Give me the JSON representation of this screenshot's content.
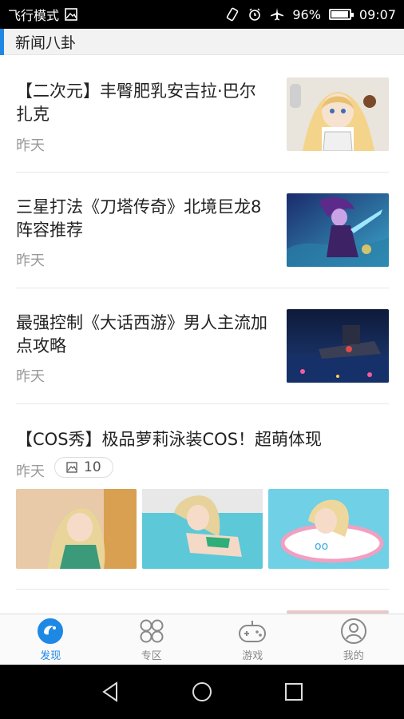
{
  "status_bar": {
    "mode_label": "飞行模式",
    "battery_percent": "96%",
    "battery_level": 0.96,
    "time": "09:07"
  },
  "section": {
    "title": "新闻八卦"
  },
  "news": [
    {
      "title": "【二次元】丰臀肥乳安吉拉·巴尔扎克",
      "time": "昨天"
    },
    {
      "title": "三星打法《刀塔传奇》北境巨龙8阵容推荐",
      "time": "昨天"
    },
    {
      "title": "最强控制《大话西游》男人主流加点攻略",
      "time": "昨天"
    },
    {
      "title": "【COS秀】极品萝莉泳装COS！超萌体现",
      "time": "昨天",
      "image_count": "10"
    }
  ],
  "tabs": [
    {
      "label": "发现",
      "icon": "discover-icon",
      "active": true
    },
    {
      "label": "专区",
      "icon": "grid-icon",
      "active": false
    },
    {
      "label": "游戏",
      "icon": "gamepad-icon",
      "active": false
    },
    {
      "label": "我的",
      "icon": "profile-icon",
      "active": false
    }
  ],
  "colors": {
    "accent": "#1e88e5",
    "text": "#222222",
    "muted": "#999999"
  }
}
